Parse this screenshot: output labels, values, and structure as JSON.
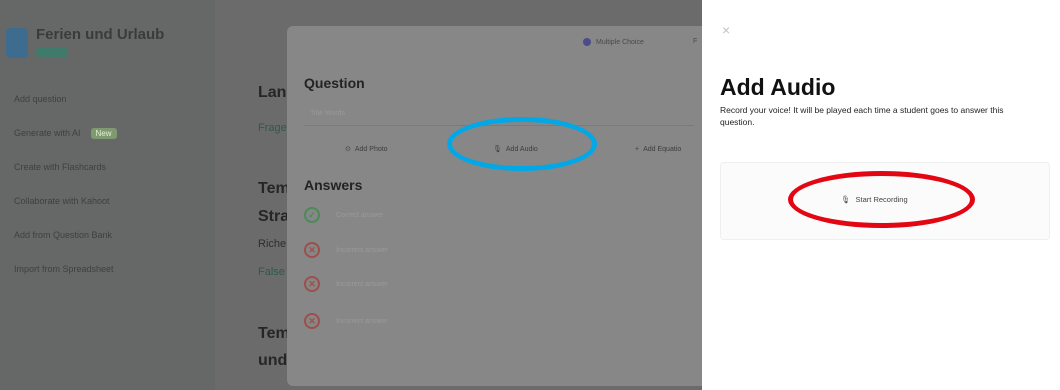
{
  "sidebar": {
    "set_title": "Ferien und Urlaub",
    "items": [
      {
        "label": "Add question"
      },
      {
        "label": "Generate with AI",
        "tag": "New"
      },
      {
        "label": "Create with Flashcards"
      },
      {
        "label": "Collaborate with Kahoot"
      },
      {
        "label": "Add from Question Bank"
      },
      {
        "label": "Import from Spreadsheet"
      }
    ]
  },
  "background": {
    "heading1": "Lan",
    "sub1": "Frage",
    "heading2_line1": "Tem",
    "heading2_line2": "Stra",
    "sub2": "Riche",
    "sub3": "False",
    "heading3_line1": "Tem",
    "heading3_line2": "und"
  },
  "question_modal": {
    "type_label": "Multiple Choice",
    "question_label": "Question",
    "question_placeholder": "Title Words",
    "tools": {
      "add_photo": "Add Photo",
      "add_audio": "Add Audio",
      "add_equation": "Add Equatio"
    },
    "answers_label": "Answers",
    "answers": [
      {
        "text": "Correct answer",
        "correct": true
      },
      {
        "text": "Incorrect answer",
        "correct": false
      },
      {
        "text": "Incorrect answer",
        "correct": false
      },
      {
        "text": "Incorrect answer",
        "correct": false
      }
    ]
  },
  "audio_panel": {
    "close_icon": "×",
    "title": "Add Audio",
    "description": "Record your voice! It will be played each time a student goes to answer this question.",
    "start_recording": "Start Recording"
  },
  "colors": {
    "highlight_blue": "#00a8e8",
    "highlight_red": "#e30613"
  },
  "icons": {
    "close": "close-icon",
    "microphone": "microphone-icon",
    "photo": "photo-icon",
    "equation": "equation-icon",
    "check": "check-icon",
    "cross": "cross-icon"
  }
}
